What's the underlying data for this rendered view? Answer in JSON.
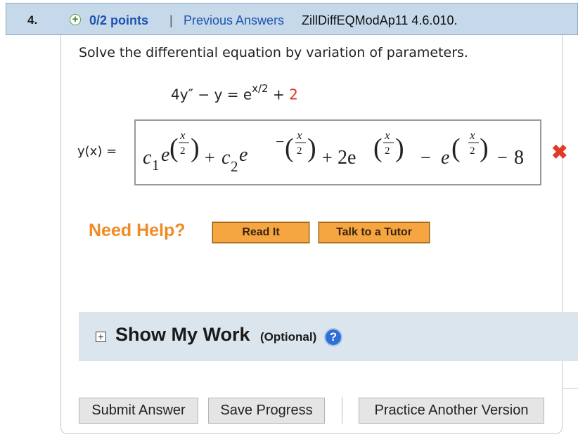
{
  "question": {
    "number": "4.",
    "points": "0/2 points",
    "separator": "|",
    "previous_answers": "Previous Answers",
    "question_id": "ZillDiffEQModAp11 4.6.010."
  },
  "problem": {
    "prompt": "Solve the differential equation by variation of parameters.",
    "equation": {
      "lhs": "4y″ − y = e",
      "exponent": "x/2",
      "plus": " + ",
      "constant": "2"
    }
  },
  "answer": {
    "label": "y(x) =",
    "terms": {
      "c": "c",
      "e": "e",
      "sub1": "1",
      "sub2": "2",
      "x": "x",
      "two": "2",
      "coef2e": "2e",
      "plus": "+",
      "minus": "−",
      "neg": "−",
      "paren_l": "(",
      "paren_r": ")",
      "eight": "8"
    },
    "status": "incorrect",
    "status_icon": "✖"
  },
  "help": {
    "label": "Need Help?",
    "read_it": "Read It",
    "talk_to_tutor": "Talk to a Tutor"
  },
  "work": {
    "expand_symbol": "+",
    "title": "Show My Work",
    "optional": "(Optional)",
    "help_symbol": "?"
  },
  "actions": {
    "submit": "Submit Answer",
    "save": "Save Progress",
    "practice": "Practice Another Version"
  },
  "colors": {
    "header_bg": "#c5d9ea",
    "link_blue": "#1f52b0",
    "red": "#e0331f",
    "orange": "#f08a24",
    "button_orange": "#f6a640",
    "panel_bg": "#dbe5ee"
  }
}
